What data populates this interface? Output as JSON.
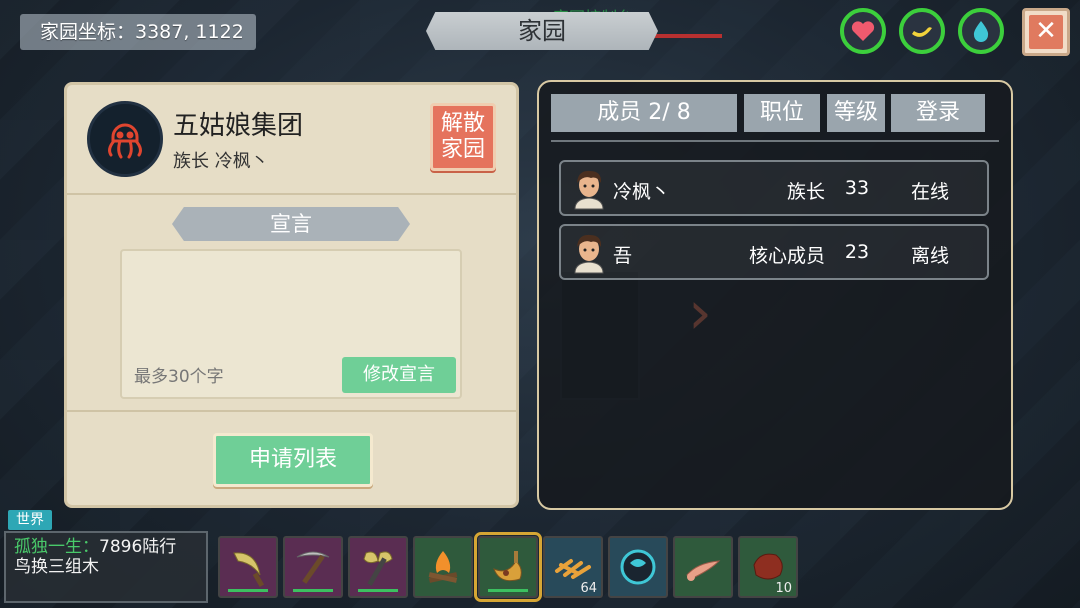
{
  "top": {
    "coords_label": "家园坐标：3387, 1122",
    "title": "家园",
    "ghost_text": "家园控制台",
    "icons": [
      "heart-icon",
      "banana-icon",
      "water-drop-icon"
    ],
    "close_label": "✕"
  },
  "clan": {
    "name": "五姑娘集团",
    "leader_line": "族长  冷枫丶",
    "disband_label_1": "解散",
    "disband_label_2": "家园",
    "declaration_title": "宣言",
    "declaration_hint": "最多30个字",
    "edit_declaration_label": "修改宣言",
    "apply_list_label": "申请列表"
  },
  "members": {
    "headers": {
      "count": "成员 2/ 8",
      "role": "职位",
      "level": "等级",
      "status": "登录"
    },
    "rows": [
      {
        "name": "冷枫丶",
        "role": "族长",
        "level": "33",
        "status": "在线"
      },
      {
        "name": "吾",
        "role": "核心成员",
        "level": "23",
        "status": "离线"
      }
    ]
  },
  "chat": {
    "channel": "世界",
    "sender": "孤独一生",
    "separator": "：",
    "message_1": "7896陆行",
    "message_2": "鸟换三组木"
  },
  "hotbar": [
    {
      "icon": "sickle-icon",
      "count": "",
      "bg": "#5a2d52"
    },
    {
      "icon": "pickaxe-icon",
      "count": "",
      "bg": "#5a2d52"
    },
    {
      "icon": "axe-icon",
      "count": "",
      "bg": "#5a2d52"
    },
    {
      "icon": "campfire-icon",
      "count": "",
      "bg": "#2f5a3c"
    },
    {
      "icon": "horn-icon",
      "count": "",
      "bg": "#2f5a3c"
    },
    {
      "icon": "fries-icon",
      "count": "64",
      "bg": "#284a5a"
    },
    {
      "icon": "orb-icon",
      "count": "",
      "bg": "#284a5a"
    },
    {
      "icon": "bone-icon",
      "count": "",
      "bg": "#2f5a3c"
    },
    {
      "icon": "meat-icon",
      "count": "10",
      "bg": "#2f5a3c"
    }
  ],
  "colors": {
    "accent_green": "#6fcf97",
    "danger": "#e5735d",
    "panel_beige": "#e6ddc6"
  }
}
